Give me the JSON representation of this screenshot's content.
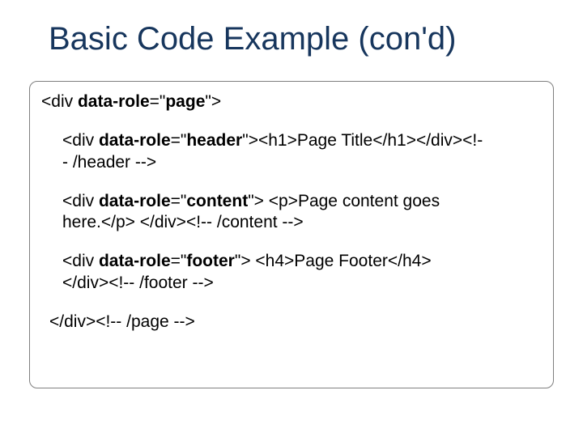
{
  "title": "Basic Code Example (con'd)",
  "code": {
    "line1_a": "<div ",
    "line1_attr": "data-role",
    "line1_b": "=\"",
    "line1_val": "page",
    "line1_c": "\">",
    "line2_a": "<div ",
    "line2_attr": "data-role",
    "line2_b": "=\"",
    "line2_val": "header",
    "line2_c": "\"><h1>Page Title</h1></div><!-",
    "line2_d": "- /header -->",
    "line3_a": "<div ",
    "line3_attr": "data-role",
    "line3_b": "=\"",
    "line3_val": "content",
    "line3_c": "\"> <p>Page content goes ",
    "line3_d": "here.</p> </div><!-- /content -->",
    "line4_a": "<div ",
    "line4_attr": "data-role",
    "line4_b": "=\"",
    "line4_val": "footer",
    "line4_c": "\"> <h4>Page Footer</h4> ",
    "line4_d": "</div><!-- /footer -->",
    "line5": "</div><!-- /page -->"
  }
}
